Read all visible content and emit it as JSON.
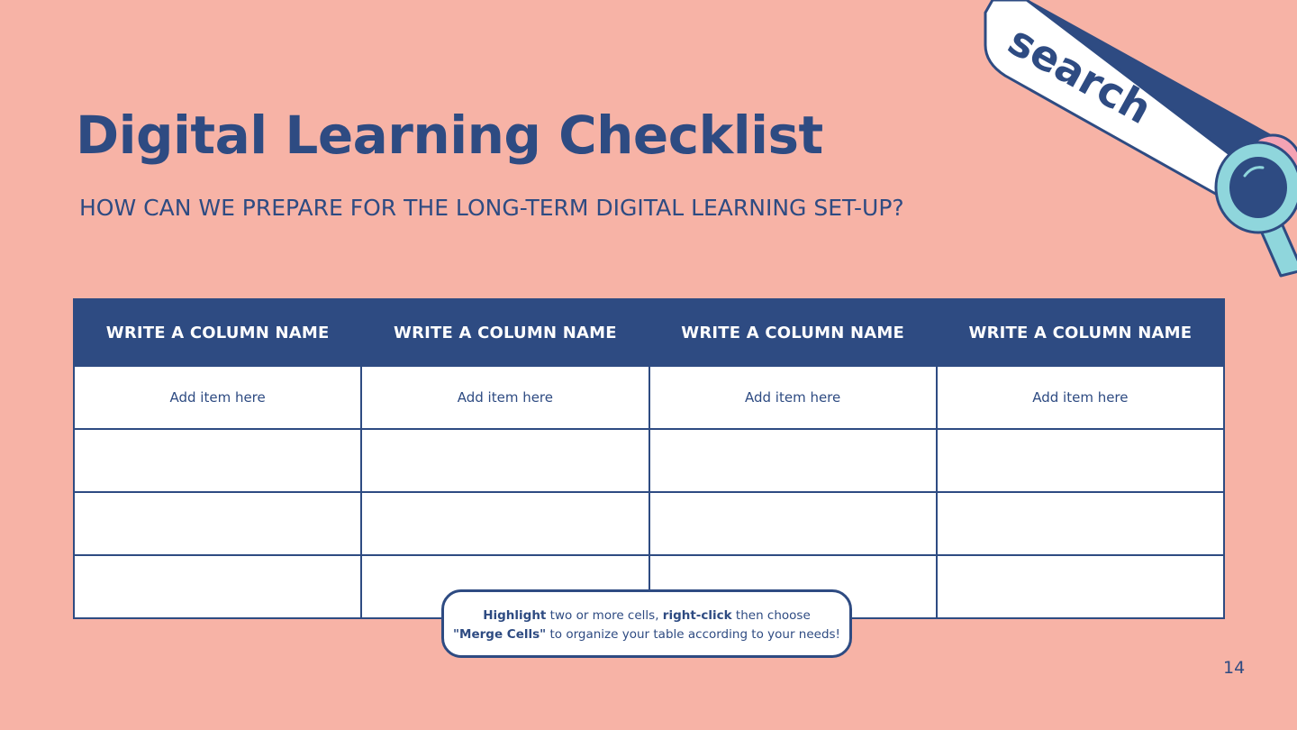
{
  "slide": {
    "title": "Digital Learning Checklist",
    "subtitle": "HOW CAN WE PREPARE FOR THE LONG-TERM DIGITAL LEARNING SET-UP?",
    "page_number": "14"
  },
  "table": {
    "headers": [
      "WRITE A COLUMN NAME",
      "WRITE A COLUMN NAME",
      "WRITE A COLUMN NAME",
      "WRITE A COLUMN NAME"
    ],
    "rows": [
      [
        "Add item here",
        "Add item here",
        "Add item here",
        "Add item here"
      ],
      [
        "",
        "",
        "",
        ""
      ],
      [
        "",
        "",
        "",
        ""
      ],
      [
        "",
        "",
        "",
        ""
      ]
    ]
  },
  "note": {
    "part1_bold": "Highlight",
    "part2": " two or more cells, ",
    "part3_bold": "right-click",
    "part4": " then choose",
    "part5_bold": "\"Merge Cells\"",
    "part6": " to organize your table according to your needs!"
  },
  "decoration": {
    "search_label": "search",
    "icon": "magnifier-search-bar-icon",
    "colors": {
      "navy": "#2e4b82",
      "teal": "#8fd6dc",
      "pink": "#f7b3a6",
      "white": "#ffffff"
    }
  }
}
